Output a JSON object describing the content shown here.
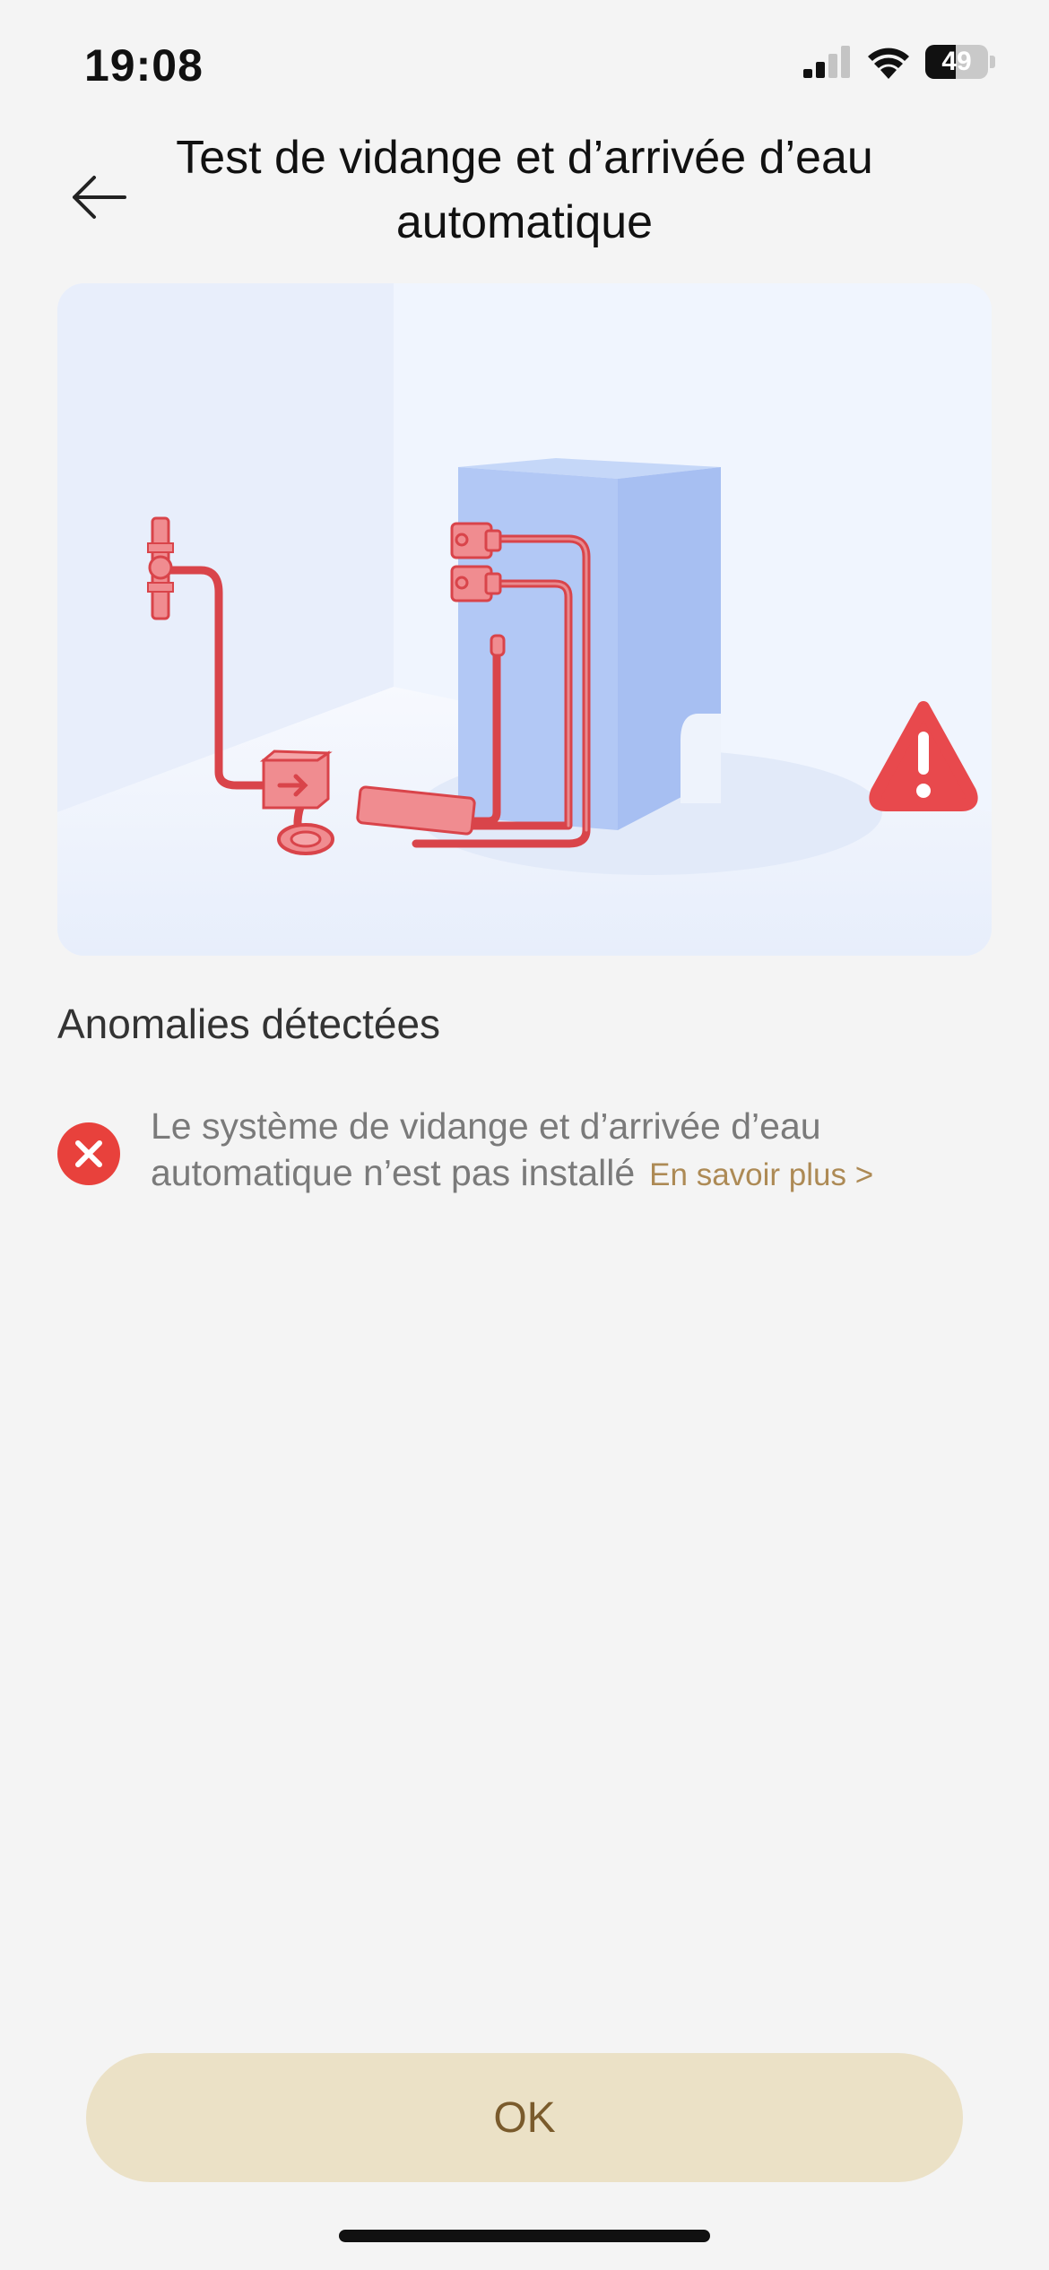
{
  "status_bar": {
    "time": "19:08",
    "battery": "49"
  },
  "header": {
    "title": "Test de vidange et d’arrivée d’eau automatique"
  },
  "anomalies": {
    "section_title": "Anomalies détectées",
    "items": [
      {
        "text": "Le système de vidange et d’arrivée d’eau automatique n’est pas installé",
        "link": "En savoir plus >",
        "status_color": "#e8413c"
      }
    ]
  },
  "footer": {
    "ok_label": "OK"
  },
  "colors": {
    "accent": "#ad8a55",
    "button_bg": "#ebe1c6",
    "pipe_red": "#d9444a",
    "device_blue": "#b0c8f5",
    "warning_red": "#e8494d"
  },
  "icons": [
    "signal-icon",
    "wifi-icon",
    "battery-icon",
    "back-arrow-icon",
    "warning-icon",
    "error-icon"
  ]
}
